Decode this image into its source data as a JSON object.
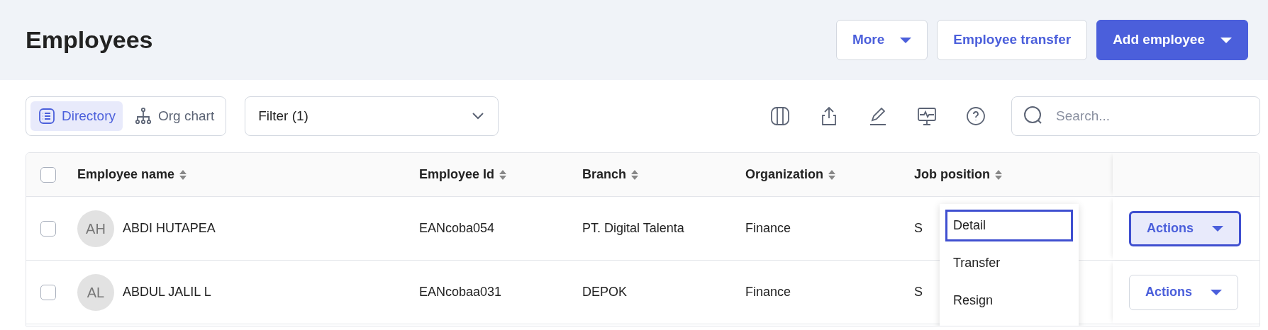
{
  "page": {
    "title": "Employees"
  },
  "header_buttons": [
    {
      "label": "More",
      "kind": "dropdown-outline"
    },
    {
      "label": "Employee transfer",
      "kind": "outline"
    },
    {
      "label": "Add employee",
      "kind": "dropdown-primary"
    }
  ],
  "view_toggle": [
    {
      "label": "Directory",
      "kind": "list",
      "selected": true
    },
    {
      "label": "Org chart",
      "kind": "tree",
      "selected": false
    }
  ],
  "filter": {
    "label": "Filter (1)"
  },
  "search": {
    "placeholder": "Search..."
  },
  "table": {
    "select_all_checked": false,
    "columns": [
      "Employee name",
      "Employee Id",
      "Branch",
      "Organization",
      "Job position"
    ],
    "rows": [
      {
        "checked": false,
        "initials": "AH",
        "name": "ABDI HUTAPEA",
        "employee_id": "EANcoba054",
        "branch": "PT. Digital Talenta",
        "organization": "Finance",
        "job_position": "S",
        "actions": "Actions",
        "actions_open": true
      },
      {
        "checked": false,
        "initials": "AL",
        "name": "ABDUL JALIL L",
        "employee_id": "EANcobaa031",
        "branch": "DEPOK",
        "organization": "Finance",
        "job_position": "S",
        "actions": "Actions",
        "actions_open": false
      }
    ]
  },
  "action_menu": {
    "items": [
      {
        "label": "Detail",
        "focused": true
      },
      {
        "label": "Transfer",
        "focused": false
      },
      {
        "label": "Resign",
        "focused": false
      }
    ]
  }
}
